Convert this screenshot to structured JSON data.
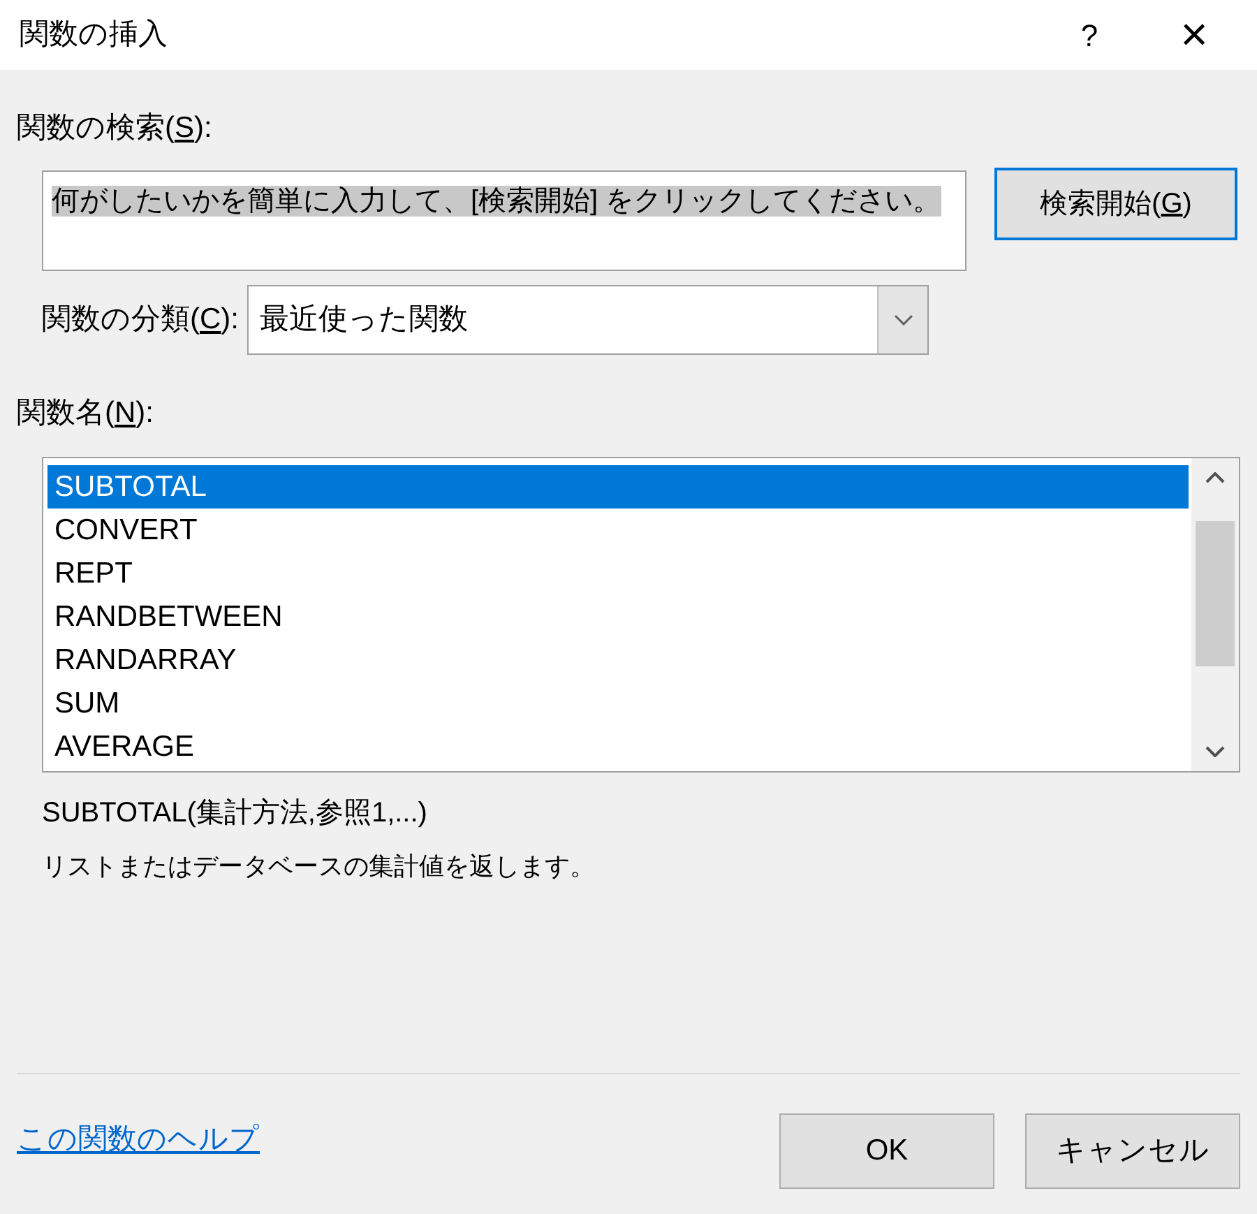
{
  "window": {
    "title": "関数の挿入",
    "help": "?",
    "close": "×"
  },
  "search": {
    "label": {
      "before": "関数の検索(",
      "key": "S",
      "after": "):"
    },
    "value": "何がしたいかを簡単に入力して、[検索開始] をクリックしてください。",
    "selected": true,
    "button": {
      "before": "検索開始(",
      "key": "G",
      "after": ")"
    },
    "button_focused": true
  },
  "category": {
    "label": {
      "before": "関数の分類(",
      "key": "C",
      "after": "):"
    },
    "value": "最近使った関数"
  },
  "functions": {
    "label": {
      "before": "関数名(",
      "key": "N",
      "after": "):"
    },
    "items": [
      {
        "name": "SUBTOTAL",
        "selected": true
      },
      {
        "name": "CONVERT",
        "selected": false
      },
      {
        "name": "REPT",
        "selected": false
      },
      {
        "name": "RANDBETWEEN",
        "selected": false
      },
      {
        "name": "RANDARRAY",
        "selected": false
      },
      {
        "name": "SUM",
        "selected": false
      },
      {
        "name": "AVERAGE",
        "selected": false
      }
    ]
  },
  "syntax": "SUBTOTAL(集計方法,参照1,...)",
  "description": "リストまたはデータベースの集計値を返します。",
  "help_link": "この関数のヘルプ",
  "buttons": [
    "OK",
    "キャンセル"
  ]
}
